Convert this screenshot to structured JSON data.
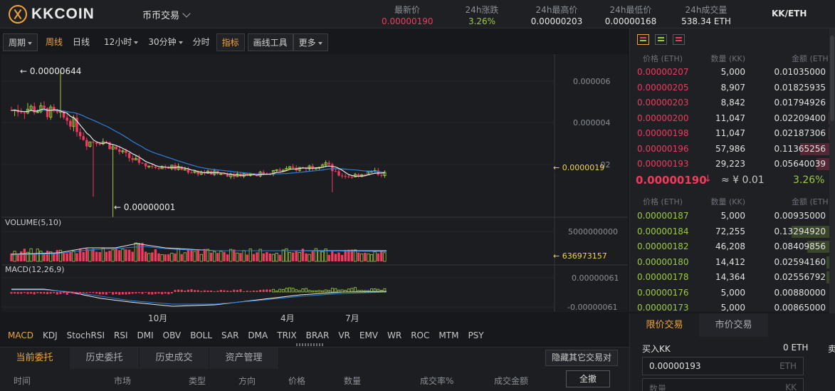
{
  "header": {
    "brand": "KKCOIN",
    "market_menu": "币币交易",
    "stats": [
      {
        "label": "最新价",
        "value": "0.00000190",
        "color": "#f23a5e"
      },
      {
        "label": "24h涨跌",
        "value": "3.26%",
        "color": "#9ecb3d"
      },
      {
        "label": "24h最高价",
        "value": "0.00000203",
        "color": "#e6e6e6"
      },
      {
        "label": "24h最低价",
        "value": "0.00000168",
        "color": "#e6e6e6"
      },
      {
        "label": "24h成交量",
        "value": "538.34 ETH",
        "color": "#e6e6e6"
      }
    ],
    "pair": "KK/ETH"
  },
  "toolbar": {
    "period": "周期",
    "weekly": "周线",
    "daily": "日线",
    "h12": "12小时",
    "m30": "30分钟",
    "time": "分时",
    "indicator": "指标",
    "draw": "画线工具",
    "more": "更多"
  },
  "chart": {
    "max_label": "← 0.00000644",
    "min_label": "← 0.00000001",
    "y_ticks": [
      "0.000006",
      "0.000004",
      "0.000002"
    ],
    "last_price_tag": "← 0.0000019",
    "volume_title": "VOLUME(5,10)",
    "volume_tick": "5000000000",
    "volume_tag": "← 636973157",
    "macd_title": "MACD(12,26,9)",
    "macd_ticks": [
      "0.00000061",
      "-0.00000061"
    ],
    "x_labels": [
      "10月",
      "4月",
      "7月"
    ]
  },
  "chart_data": {
    "type": "candlestick",
    "y_unit": "ETH",
    "y_axis_ticks": [
      6e-06,
      4e-06,
      2e-06
    ],
    "annotations": {
      "high": 6.44e-06,
      "low": 1e-08,
      "last": 1.9e-06
    },
    "x_axis_ticks": [
      "10月",
      "4月",
      "7月"
    ],
    "volume": {
      "axis_tick": 5000000000,
      "last": 636973157
    },
    "macd": {
      "params": "12,26,9",
      "axis_ticks": [
        6.1e-07,
        -6.1e-07
      ]
    }
  },
  "indicators": [
    "MACD",
    "KDJ",
    "StochRSI",
    "RSI",
    "DMI",
    "OBV",
    "BOLL",
    "SAR",
    "DMA",
    "TRIX",
    "BRAR",
    "VR",
    "EMV",
    "WR",
    "ROC",
    "MTM",
    "PSY"
  ],
  "orderbook": {
    "head": {
      "price": "价格 (ETH)",
      "qty": "数量 (KK)",
      "amount": "金额 (ETH)"
    },
    "asks": [
      {
        "price": "0.00000207",
        "qty": "5,000",
        "amount": "0.01035000",
        "depth": 0.05
      },
      {
        "price": "0.00000205",
        "qty": "8,907",
        "amount": "0.01825935",
        "depth": 0.08
      },
      {
        "price": "0.00000203",
        "qty": "8,842",
        "amount": "0.01794926",
        "depth": 0.08
      },
      {
        "price": "0.00000200",
        "qty": "11,047",
        "amount": "0.02209400",
        "depth": 0.1
      },
      {
        "price": "0.00000198",
        "qty": "11,047",
        "amount": "0.02187306",
        "depth": 0.1
      },
      {
        "price": "0.00000196",
        "qty": "57,986",
        "amount": "0.11365256",
        "depth": 0.5
      },
      {
        "price": "0.00000193",
        "qty": "29,223",
        "amount": "0.05640039",
        "depth": 0.27
      }
    ],
    "last": {
      "price": "0.00000190",
      "arrow": "↓",
      "cny": "≈ ¥ 0.01",
      "change": "3.26%"
    },
    "bids": [
      {
        "price": "0.00000187",
        "qty": "5,000",
        "amount": "0.00935000",
        "depth": 0.05
      },
      {
        "price": "0.00000184",
        "qty": "72,255",
        "amount": "0.13294920",
        "depth": 0.62
      },
      {
        "price": "0.00000182",
        "qty": "46,208",
        "amount": "0.08409856",
        "depth": 0.4
      },
      {
        "price": "0.00000180",
        "qty": "14,412",
        "amount": "0.02594160",
        "depth": 0.13
      },
      {
        "price": "0.00000178",
        "qty": "14,364",
        "amount": "0.02556792",
        "depth": 0.13
      },
      {
        "price": "0.00000176",
        "qty": "5,000",
        "amount": "0.00880000",
        "depth": 0.05
      },
      {
        "price": "0.00000173",
        "qty": "5,000",
        "amount": "0.00865000",
        "depth": 0.05
      }
    ]
  },
  "orders": {
    "tabs": [
      "当前委托",
      "历史委托",
      "历史成交",
      "资产管理"
    ],
    "hide_btn": "隐藏其它交易对",
    "columns": [
      "时间",
      "市场",
      "类型",
      "方向",
      "价格",
      "数量",
      "成交率%",
      "成交金额"
    ],
    "cancel_all": "全撤"
  },
  "trade": {
    "tabs": [
      "限价交易",
      "市价交易"
    ],
    "buy_title": "买入KK",
    "balance": "0 ETH",
    "price_value": "0.00000193",
    "price_unit": "ETH",
    "qty_placeholder": "数量",
    "qty_unit": "KK",
    "sell_fragment": "卖"
  },
  "colors": {
    "up": "#9ecb3d",
    "down": "#f23a5e",
    "accent": "#f0a33b",
    "ma_white": "#e8e8e8",
    "ma_blue": "#2f7fd6"
  }
}
